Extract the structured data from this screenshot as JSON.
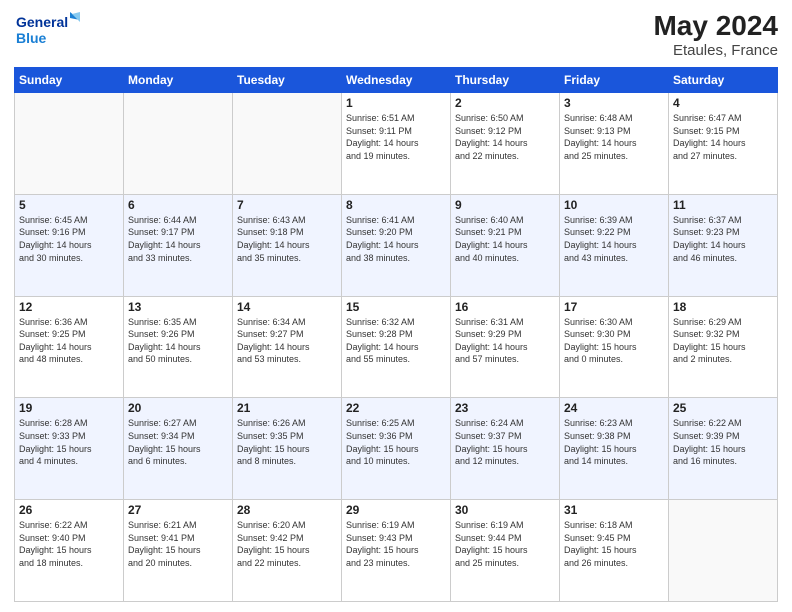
{
  "header": {
    "logo_line1": "General",
    "logo_line2": "Blue",
    "month_year": "May 2024",
    "location": "Etaules, France"
  },
  "days_of_week": [
    "Sunday",
    "Monday",
    "Tuesday",
    "Wednesday",
    "Thursday",
    "Friday",
    "Saturday"
  ],
  "weeks": [
    [
      {
        "day": "",
        "info": ""
      },
      {
        "day": "",
        "info": ""
      },
      {
        "day": "",
        "info": ""
      },
      {
        "day": "1",
        "info": "Sunrise: 6:51 AM\nSunset: 9:11 PM\nDaylight: 14 hours\nand 19 minutes."
      },
      {
        "day": "2",
        "info": "Sunrise: 6:50 AM\nSunset: 9:12 PM\nDaylight: 14 hours\nand 22 minutes."
      },
      {
        "day": "3",
        "info": "Sunrise: 6:48 AM\nSunset: 9:13 PM\nDaylight: 14 hours\nand 25 minutes."
      },
      {
        "day": "4",
        "info": "Sunrise: 6:47 AM\nSunset: 9:15 PM\nDaylight: 14 hours\nand 27 minutes."
      }
    ],
    [
      {
        "day": "5",
        "info": "Sunrise: 6:45 AM\nSunset: 9:16 PM\nDaylight: 14 hours\nand 30 minutes."
      },
      {
        "day": "6",
        "info": "Sunrise: 6:44 AM\nSunset: 9:17 PM\nDaylight: 14 hours\nand 33 minutes."
      },
      {
        "day": "7",
        "info": "Sunrise: 6:43 AM\nSunset: 9:18 PM\nDaylight: 14 hours\nand 35 minutes."
      },
      {
        "day": "8",
        "info": "Sunrise: 6:41 AM\nSunset: 9:20 PM\nDaylight: 14 hours\nand 38 minutes."
      },
      {
        "day": "9",
        "info": "Sunrise: 6:40 AM\nSunset: 9:21 PM\nDaylight: 14 hours\nand 40 minutes."
      },
      {
        "day": "10",
        "info": "Sunrise: 6:39 AM\nSunset: 9:22 PM\nDaylight: 14 hours\nand 43 minutes."
      },
      {
        "day": "11",
        "info": "Sunrise: 6:37 AM\nSunset: 9:23 PM\nDaylight: 14 hours\nand 46 minutes."
      }
    ],
    [
      {
        "day": "12",
        "info": "Sunrise: 6:36 AM\nSunset: 9:25 PM\nDaylight: 14 hours\nand 48 minutes."
      },
      {
        "day": "13",
        "info": "Sunrise: 6:35 AM\nSunset: 9:26 PM\nDaylight: 14 hours\nand 50 minutes."
      },
      {
        "day": "14",
        "info": "Sunrise: 6:34 AM\nSunset: 9:27 PM\nDaylight: 14 hours\nand 53 minutes."
      },
      {
        "day": "15",
        "info": "Sunrise: 6:32 AM\nSunset: 9:28 PM\nDaylight: 14 hours\nand 55 minutes."
      },
      {
        "day": "16",
        "info": "Sunrise: 6:31 AM\nSunset: 9:29 PM\nDaylight: 14 hours\nand 57 minutes."
      },
      {
        "day": "17",
        "info": "Sunrise: 6:30 AM\nSunset: 9:30 PM\nDaylight: 15 hours\nand 0 minutes."
      },
      {
        "day": "18",
        "info": "Sunrise: 6:29 AM\nSunset: 9:32 PM\nDaylight: 15 hours\nand 2 minutes."
      }
    ],
    [
      {
        "day": "19",
        "info": "Sunrise: 6:28 AM\nSunset: 9:33 PM\nDaylight: 15 hours\nand 4 minutes."
      },
      {
        "day": "20",
        "info": "Sunrise: 6:27 AM\nSunset: 9:34 PM\nDaylight: 15 hours\nand 6 minutes."
      },
      {
        "day": "21",
        "info": "Sunrise: 6:26 AM\nSunset: 9:35 PM\nDaylight: 15 hours\nand 8 minutes."
      },
      {
        "day": "22",
        "info": "Sunrise: 6:25 AM\nSunset: 9:36 PM\nDaylight: 15 hours\nand 10 minutes."
      },
      {
        "day": "23",
        "info": "Sunrise: 6:24 AM\nSunset: 9:37 PM\nDaylight: 15 hours\nand 12 minutes."
      },
      {
        "day": "24",
        "info": "Sunrise: 6:23 AM\nSunset: 9:38 PM\nDaylight: 15 hours\nand 14 minutes."
      },
      {
        "day": "25",
        "info": "Sunrise: 6:22 AM\nSunset: 9:39 PM\nDaylight: 15 hours\nand 16 minutes."
      }
    ],
    [
      {
        "day": "26",
        "info": "Sunrise: 6:22 AM\nSunset: 9:40 PM\nDaylight: 15 hours\nand 18 minutes."
      },
      {
        "day": "27",
        "info": "Sunrise: 6:21 AM\nSunset: 9:41 PM\nDaylight: 15 hours\nand 20 minutes."
      },
      {
        "day": "28",
        "info": "Sunrise: 6:20 AM\nSunset: 9:42 PM\nDaylight: 15 hours\nand 22 minutes."
      },
      {
        "day": "29",
        "info": "Sunrise: 6:19 AM\nSunset: 9:43 PM\nDaylight: 15 hours\nand 23 minutes."
      },
      {
        "day": "30",
        "info": "Sunrise: 6:19 AM\nSunset: 9:44 PM\nDaylight: 15 hours\nand 25 minutes."
      },
      {
        "day": "31",
        "info": "Sunrise: 6:18 AM\nSunset: 9:45 PM\nDaylight: 15 hours\nand 26 minutes."
      },
      {
        "day": "",
        "info": ""
      }
    ]
  ]
}
